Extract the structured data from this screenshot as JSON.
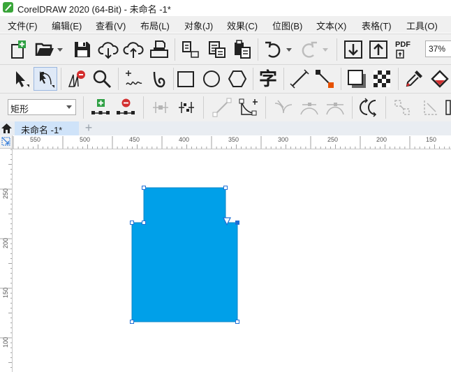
{
  "window": {
    "title": "CorelDRAW 2020 (64-Bit) - 未命名 -1*"
  },
  "menu": {
    "items": [
      "文件(F)",
      "编辑(E)",
      "查看(V)",
      "布局(L)",
      "对象(J)",
      "效果(C)",
      "位图(B)",
      "文本(X)",
      "表格(T)",
      "工具(O)"
    ]
  },
  "toolbar": {
    "pdf_label": "PDF",
    "zoom_value": "37%",
    "text_tool_label": "字"
  },
  "property_bar": {
    "shape_type": "矩形"
  },
  "tabs": {
    "home_icon": "home-icon",
    "document_tab": "未命名 -1*",
    "add_tab": "+"
  },
  "rulers": {
    "horizontal_labels": [
      "550",
      "500",
      "450",
      "400",
      "350",
      "300",
      "250",
      "200",
      "150"
    ],
    "vertical_labels": [
      "250",
      "200",
      "150",
      "100"
    ]
  },
  "colors": {
    "shape_fill": "#00a0e9",
    "selection_handle": "#1f6fd6",
    "toolbar_bg": "#f0f0f0",
    "tab_active": "#cfe3f9"
  }
}
